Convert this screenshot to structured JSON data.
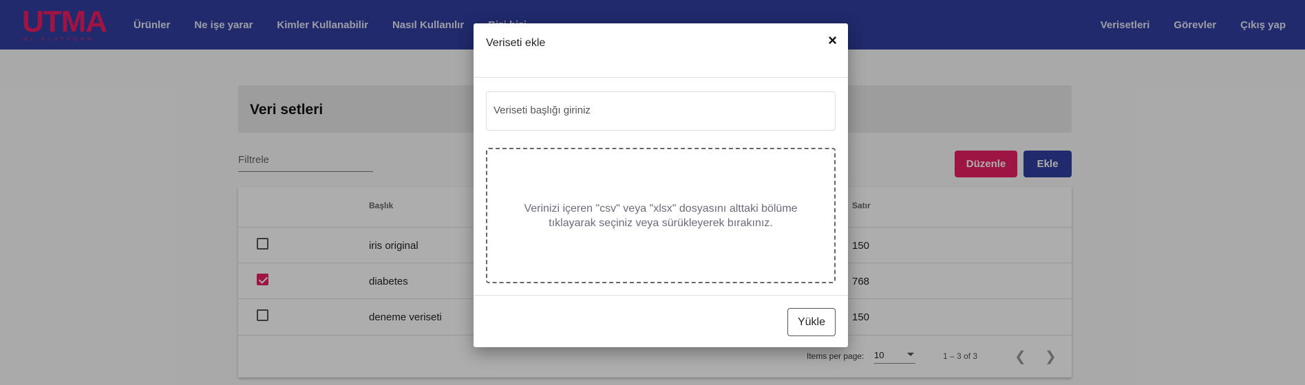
{
  "nav": {
    "logo_text": "UTMA",
    "logo_sub": "ML PLATFORM",
    "left": [
      "Ürünler",
      "Ne işe yarar",
      "Kimler Kullanabilir",
      "Nasıl Kullanılır",
      "Bizi bizi"
    ],
    "right": [
      "Verisetleri",
      "Görevler",
      "Çıkış yap"
    ]
  },
  "page": {
    "title": "Veri setleri",
    "filter_placeholder": "Filtrele",
    "edit_label": "Düzenle",
    "add_label": "Ekle"
  },
  "table": {
    "columns": [
      "Başlık",
      "Satır"
    ],
    "rows": [
      {
        "checked": false,
        "title": "iris original",
        "rows": "150"
      },
      {
        "checked": true,
        "title": "diabetes",
        "rows": "768"
      },
      {
        "checked": false,
        "title": "deneme veriseti",
        "rows": "150"
      }
    ],
    "paginator": {
      "items_per_page_label": "Items per page:",
      "page_size": "10",
      "range": "1 – 3 of 3"
    }
  },
  "modal": {
    "title": "Veriseti ekle",
    "close": "×",
    "input_placeholder": "Veriseti başlığı giriniz",
    "dropzone_text": "Verinizi içeren \"csv\" veya \"xlsx\" dosyasını alttaki bölüme tıklayarak seçiniz veya sürükleyerek bırakınız.",
    "upload_label": "Yükle"
  },
  "colors": {
    "primary": "#303f9f",
    "accent": "#e91e63"
  }
}
